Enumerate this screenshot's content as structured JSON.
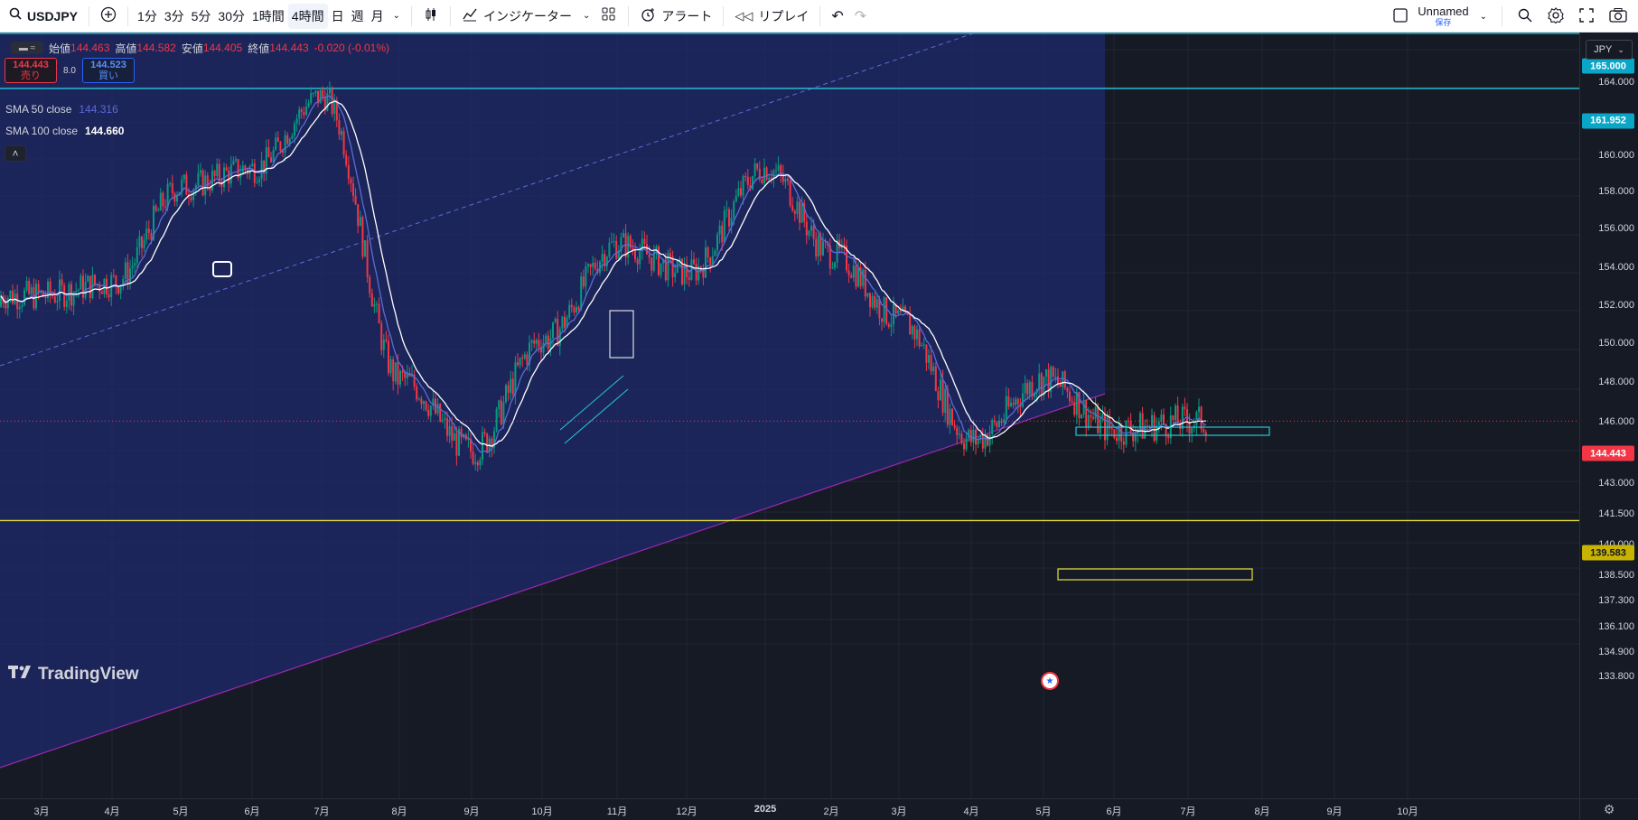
{
  "toolbar": {
    "symbol": "USDJPY",
    "add_symbol_icon": "plus-circle-icon",
    "intervals": [
      {
        "label": "1分",
        "active": false
      },
      {
        "label": "3分",
        "active": false
      },
      {
        "label": "5分",
        "active": false
      },
      {
        "label": "30分",
        "active": false
      },
      {
        "label": "1時間",
        "active": false
      },
      {
        "label": "4時間",
        "active": true
      },
      {
        "label": "日",
        "active": false
      },
      {
        "label": "週",
        "active": false
      },
      {
        "label": "月",
        "active": false
      }
    ],
    "indicators_label": "インジケーター",
    "alert_label": "アラート",
    "replay_label": "リプレイ",
    "layout_name": "Unnamed",
    "layout_status": "保存"
  },
  "legend": {
    "open_label": "始値",
    "open": "144.463",
    "high_label": "高値",
    "high": "144.582",
    "low_label": "安値",
    "low": "144.405",
    "close_label": "終値",
    "close": "144.443",
    "change": "-0.020 (-0.01%)"
  },
  "trade": {
    "sell_price": "144.443",
    "sell_label": "売り",
    "spread": "8.0",
    "buy_price": "144.523",
    "buy_label": "買い"
  },
  "indicators": [
    {
      "name": "SMA 50 close",
      "value": "144.316",
      "color": "#5b6bd6"
    },
    {
      "name": "SMA 100 close",
      "value": "144.660",
      "color": "#ffffff"
    }
  ],
  "currency": "JPY",
  "price_axis": {
    "ticks": [
      "164.000",
      "162.000",
      "160.000",
      "158.000",
      "156.000",
      "154.000",
      "152.000",
      "150.000",
      "148.000",
      "146.000",
      "143.000",
      "141.500",
      "140.000",
      "138.500",
      "137.300",
      "136.100",
      "134.900",
      "133.800"
    ],
    "tags": [
      {
        "value": "165.000",
        "color": "#0aa6c8"
      },
      {
        "value": "161.952",
        "color": "#0aa6c8"
      },
      {
        "value": "144.443",
        "color": "#f23645"
      },
      {
        "value": "139.583",
        "color": "#c8b400"
      }
    ]
  },
  "time_axis": [
    "3月",
    "4月",
    "5月",
    "6月",
    "7月",
    "8月",
    "9月",
    "10月",
    "11月",
    "12月",
    "2025",
    "2月",
    "3月",
    "4月",
    "5月",
    "6月",
    "7月",
    "8月",
    "9月",
    "10月"
  ],
  "watermark": "TradingView",
  "chart_data": {
    "type": "candlestick",
    "symbol": "USDJPY",
    "interval": "4時間",
    "ylim": [
      133.8,
      165.0
    ],
    "x": [
      "2024-03",
      "2024-04",
      "2024-05",
      "2024-06",
      "2024-07",
      "2024-08",
      "2024-09",
      "2024-10",
      "2024-11",
      "2024-12",
      "2025-01",
      "2025-02",
      "2025-03",
      "2025-04",
      "2025-05",
      "2025-06",
      "2025-07"
    ],
    "close": [
      150.8,
      151.5,
      156.5,
      157.5,
      161.5,
      146.5,
      143.0,
      148.5,
      153.5,
      152.0,
      157.5,
      153.0,
      149.5,
      143.5,
      146.5,
      144.0,
      144.44
    ],
    "horizontal_lines": [
      165.0,
      161.952,
      139.583
    ],
    "last_price": 144.443,
    "series": [
      {
        "name": "SMA 50 close",
        "last": 144.316
      },
      {
        "name": "SMA 100 close",
        "last": 144.66
      }
    ],
    "colors": {
      "up": "#089981",
      "down": "#f23645",
      "background": "#161a25",
      "channel": "#1e2a6e"
    }
  }
}
